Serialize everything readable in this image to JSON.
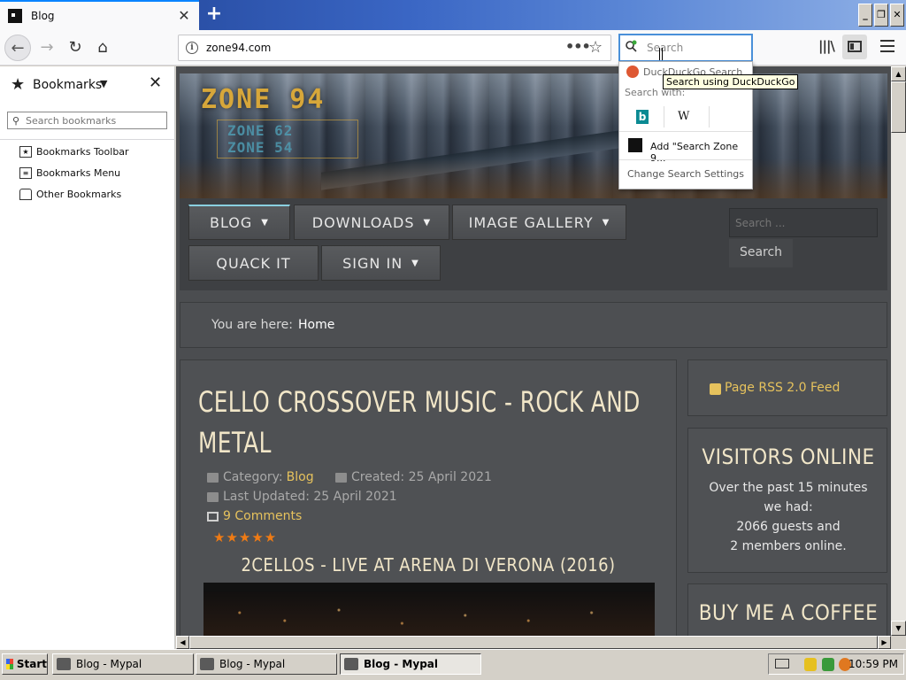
{
  "browser": {
    "tab_title": "Blog",
    "new_tab": "+",
    "url": "zone94.com",
    "search_placeholder": "Search",
    "window_buttons": [
      "_",
      "❐",
      "✕"
    ]
  },
  "sidebar": {
    "title": "Bookmarks",
    "search_placeholder": "Search bookmarks",
    "items": [
      {
        "label": "Bookmarks Toolbar",
        "icon": "star-box-icon"
      },
      {
        "label": "Bookmarks Menu",
        "icon": "menu-list-icon"
      },
      {
        "label": "Other Bookmarks",
        "icon": "folder-icon"
      }
    ]
  },
  "search_dropdown": {
    "engine": "DuckDuckGo Search",
    "search_with": "Search with:",
    "engines": [
      "bing",
      "W"
    ],
    "add_engine": "Add \"Search Zone 9...",
    "change_settings": "Change Search Settings",
    "tooltip": "Search using DuckDuckGo"
  },
  "site": {
    "logo_main": "ZONE 94",
    "logo_sub1": "ZONE 62",
    "logo_sub2": "ZONE 54",
    "nav": [
      {
        "label": "BLOG",
        "dropdown": true,
        "active": true
      },
      {
        "label": "DOWNLOADS",
        "dropdown": true
      },
      {
        "label": "IMAGE GALLERY",
        "dropdown": true
      },
      {
        "label": "QUACK IT",
        "dropdown": false
      },
      {
        "label": "SIGN IN",
        "dropdown": true
      }
    ],
    "nav_search_placeholder": "Search ...",
    "nav_search_button": "Search",
    "breadcrumb_label": "You are here:",
    "breadcrumb_home": "Home",
    "article": {
      "title": "CELLO CROSSOVER MUSIC - ROCK AND METAL",
      "category_label": "Category:",
      "category": "Blog",
      "created": "Created: 25 April 2021",
      "updated": "Last Updated: 25 April 2021",
      "comments": "9 Comments",
      "rating": 5,
      "stars": "★★★★★",
      "subtitle": "2CELLOS - LIVE AT ARENA DI VERONA (2016)"
    },
    "rss": "Page RSS 2.0 Feed",
    "visitors_title": "VISITORS ONLINE",
    "visitors_body": [
      "Over the past 15 minutes",
      "we had:",
      "2066 guests and",
      "2 members online."
    ],
    "coffee_title": "BUY ME A COFFEE"
  },
  "taskbar": {
    "start": "Start",
    "tasks": [
      {
        "label": "Blog - Mypal",
        "active": false
      },
      {
        "label": "Blog - Mypal",
        "active": false
      },
      {
        "label": "Blog - Mypal",
        "active": true
      }
    ],
    "clock": "10:59 PM"
  },
  "colors": {
    "accent": "#e6c25d",
    "title_text": "#f1e6c8",
    "rating": "#f07b14",
    "page_bg": "#4b4d50"
  }
}
